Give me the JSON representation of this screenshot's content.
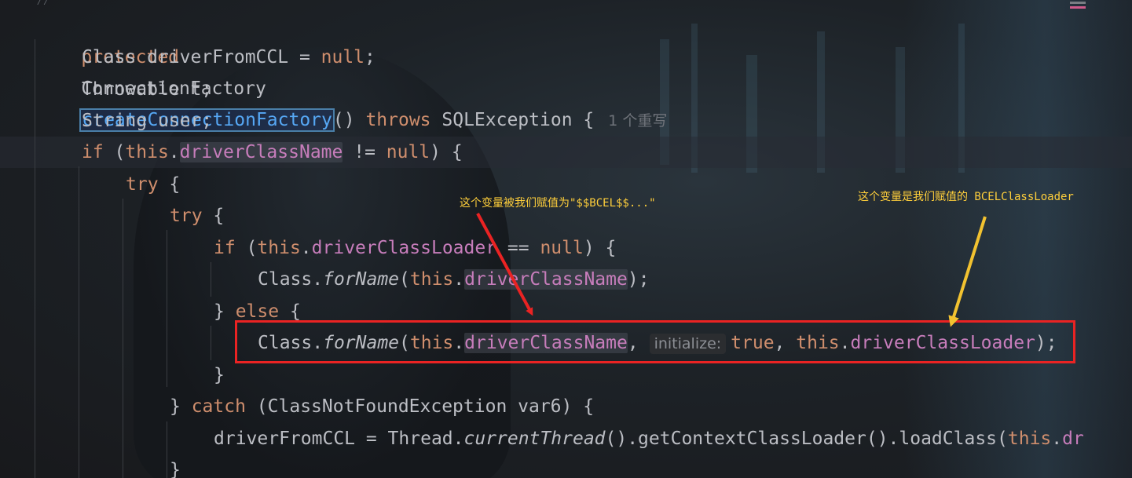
{
  "code": {
    "line1": {
      "kw": "protected",
      "type": "ConnectionFactory",
      "method": "createConnectionFactory",
      "rest": "() ",
      "throws": "throws",
      "exception": " SQLException {",
      "usages": "1 个重写"
    },
    "line2": {
      "type": "Class driverFromCCL = ",
      "null": "null",
      "end": ";"
    },
    "line3": {
      "text": "Throwable t;"
    },
    "line4": {
      "text": "String user;"
    },
    "line5": {
      "if": "if",
      "open": " (",
      "this": "this",
      "dot": ".",
      "field": "driverClassName",
      "op": " != ",
      "null": "null",
      "close": ") {"
    },
    "line6": {
      "try": "try",
      "brace": " {"
    },
    "line7": {
      "try": "try",
      "brace": " {"
    },
    "line8": {
      "if": "if",
      "open": " (",
      "this": "this",
      "dot": ".",
      "field": "driverClassLoader",
      "op": " == ",
      "null": "null",
      "close": ") {"
    },
    "line9": {
      "cls": "Class.",
      "fn": "forName",
      "open": "(",
      "this": "this",
      "dot": ".",
      "field": "driverClassName",
      "close": ");"
    },
    "line10": {
      "brace": "} ",
      "else": "else",
      "open": " {"
    },
    "line11": {
      "cls": "Class.",
      "fn": "forName",
      "open": "(",
      "this": "this",
      "dot": ".",
      "field": "driverClassName",
      "comma": ", ",
      "hint": "initialize:",
      "true": "true",
      "comma2": ", ",
      "this2": "this",
      "dot2": ".",
      "field2": "driverClassLoader",
      "close": ");"
    },
    "line12": {
      "text": "}"
    },
    "line13": {
      "brace": "} ",
      "catch": "catch",
      "rest": " (ClassNotFoundException var6) {"
    },
    "line14": {
      "pre": "driverFromCCL = Thread.",
      "fn": "currentThread",
      "mid": "().getContextClassLoader().loadClass(",
      "this": "this",
      "dot": ".",
      "cut": "dr"
    },
    "line15": {
      "text": "}"
    }
  },
  "annotations": {
    "left_note": "这个变量被我们赋值为\"$$BCEL$$...\"",
    "right_note": "这个变量是我们赋值的 BCELClassLoader",
    "box_color": "#ea2323",
    "note_color": "#ffcf3b",
    "left_arrow_color": "#ea2323",
    "right_arrow_color": "#f2c230"
  }
}
